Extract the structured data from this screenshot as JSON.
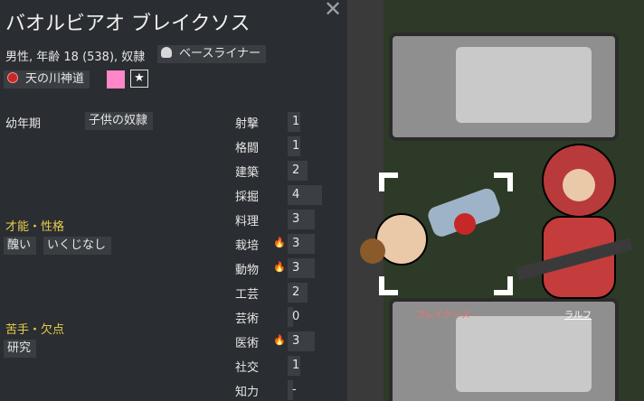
{
  "pawn": {
    "name": "バオルビアオ ブレイクソス",
    "info": "男性, 年齢 18 (538), 奴隷",
    "xenotype": "ベースライナー",
    "ideology": "天の川神道",
    "favorite_color": "#ff86c8"
  },
  "backstory": {
    "label": "幼年期",
    "value": "子供の奴隷"
  },
  "traits": {
    "title": "才能・性格",
    "items": [
      "醜い",
      "いくじなし"
    ]
  },
  "incapable": {
    "title": "苦手・欠点",
    "items": [
      "研究"
    ]
  },
  "skills": [
    {
      "name": "射撃",
      "level": "1",
      "passion": false,
      "bar": 0.05
    },
    {
      "name": "格闘",
      "level": "1",
      "passion": false,
      "bar": 0.05
    },
    {
      "name": "建築",
      "level": "2",
      "passion": false,
      "bar": 0.1
    },
    {
      "name": "採掘",
      "level": "4",
      "passion": false,
      "bar": 0.2
    },
    {
      "name": "料理",
      "level": "3",
      "passion": false,
      "bar": 0.15
    },
    {
      "name": "栽培",
      "level": "3",
      "passion": true,
      "bar": 0.15
    },
    {
      "name": "動物",
      "level": "3",
      "passion": true,
      "bar": 0.15
    },
    {
      "name": "工芸",
      "level": "2",
      "passion": false,
      "bar": 0.1
    },
    {
      "name": "芸術",
      "level": "0",
      "passion": false,
      "bar": 0.0
    },
    {
      "name": "医術",
      "level": "3",
      "passion": true,
      "bar": 0.15
    },
    {
      "name": "社交",
      "level": "1",
      "passion": false,
      "bar": 0.05
    },
    {
      "name": "知力",
      "level": "-",
      "passion": false,
      "bar": 0.0
    }
  ],
  "map_labels": {
    "selected_pawn": "ブレイクソス",
    "other_pawn": "ラルフ"
  },
  "colors": {
    "section_header": "#e8cf4a",
    "passion": "#f5a623",
    "panel": "#2a2d31"
  }
}
